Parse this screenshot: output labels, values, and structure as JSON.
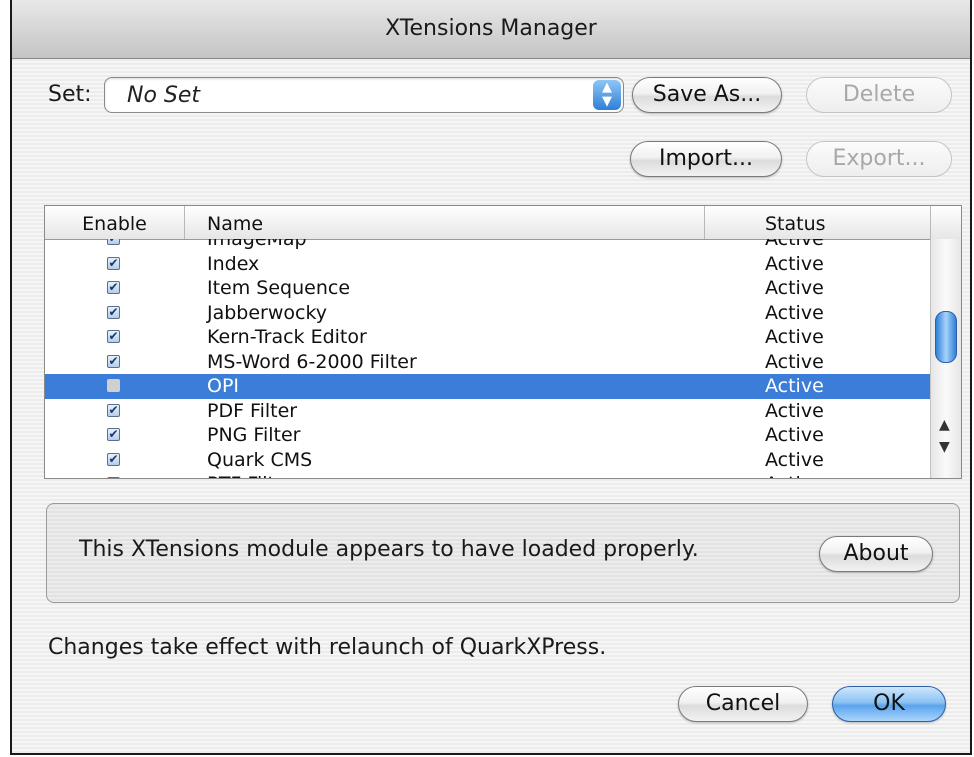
{
  "window": {
    "title": "XTensions Manager"
  },
  "set": {
    "label": "Set:",
    "value": "No Set",
    "stepper_up": "▲",
    "stepper_down": "▼"
  },
  "buttons": {
    "save_as": "Save As...",
    "delete": "Delete",
    "import": "Import...",
    "export": "Export...",
    "about": "About",
    "cancel": "Cancel",
    "ok": "OK"
  },
  "table": {
    "columns": {
      "enable": "Enable",
      "name": "Name",
      "status": "Status"
    },
    "rows": [
      {
        "enabled": true,
        "name": "ImageMap",
        "status": "Active"
      },
      {
        "enabled": true,
        "name": "Index",
        "status": "Active"
      },
      {
        "enabled": true,
        "name": "Item Sequence",
        "status": "Active"
      },
      {
        "enabled": true,
        "name": "Jabberwocky",
        "status": "Active"
      },
      {
        "enabled": true,
        "name": "Kern-Track Editor",
        "status": "Active"
      },
      {
        "enabled": true,
        "name": "MS-Word 6-2000 Filter",
        "status": "Active"
      },
      {
        "enabled": false,
        "name": "OPI",
        "status": "Active",
        "selected": true
      },
      {
        "enabled": true,
        "name": "PDF Filter",
        "status": "Active"
      },
      {
        "enabled": true,
        "name": "PNG Filter",
        "status": "Active"
      },
      {
        "enabled": true,
        "name": "Quark CMS",
        "status": "Active"
      },
      {
        "enabled": true,
        "name": "RTF Filter",
        "status": "Active"
      }
    ],
    "check_glyph": "✔",
    "scroll_up": "▲",
    "scroll_down": "▼"
  },
  "info": {
    "message": "This XTensions module appears to have loaded properly."
  },
  "footer": {
    "note": "Changes take effect with relaunch of QuarkXPress."
  },
  "colors": {
    "selection": "#3b7dd8",
    "accent": "#5ba3ec"
  }
}
